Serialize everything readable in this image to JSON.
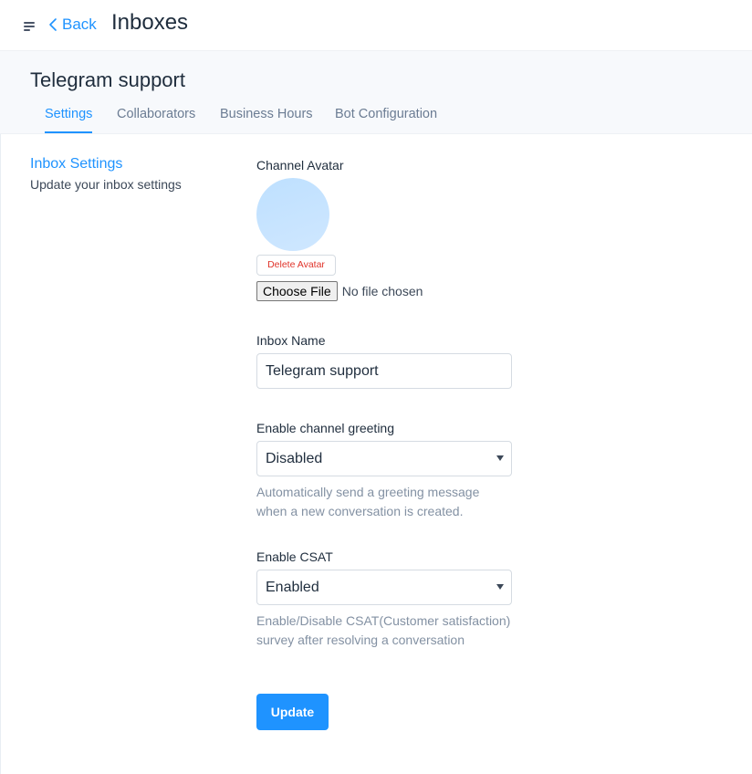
{
  "header": {
    "back_label": "Back",
    "title": "Inboxes"
  },
  "inbox": {
    "name": "Telegram support"
  },
  "tabs": [
    {
      "label": "Settings",
      "active": true
    },
    {
      "label": "Collaborators",
      "active": false
    },
    {
      "label": "Business Hours",
      "active": false
    },
    {
      "label": "Bot Configuration",
      "active": false
    }
  ],
  "section": {
    "title": "Inbox Settings",
    "description": "Update your inbox settings"
  },
  "form": {
    "avatar": {
      "label": "Channel Avatar",
      "delete_label": "Delete Avatar",
      "choose_file_label": "Choose File",
      "file_status": "No file chosen"
    },
    "inbox_name": {
      "label": "Inbox Name",
      "value": "Telegram support"
    },
    "greeting": {
      "label": "Enable channel greeting",
      "value": "Disabled",
      "help": "Automatically send a greeting message when a new conversation is created."
    },
    "csat": {
      "label": "Enable CSAT",
      "value": "Enabled",
      "help": "Enable/Disable CSAT(Customer satisfaction) survey after resolving a conversation"
    },
    "update_label": "Update"
  },
  "colors": {
    "accent": "#1f93ff",
    "danger": "#e0342b",
    "muted": "#8391a3"
  },
  "icons": {
    "menu": "menu-icon",
    "back": "chevron-left-icon",
    "select_caret": "caret-down-icon"
  }
}
